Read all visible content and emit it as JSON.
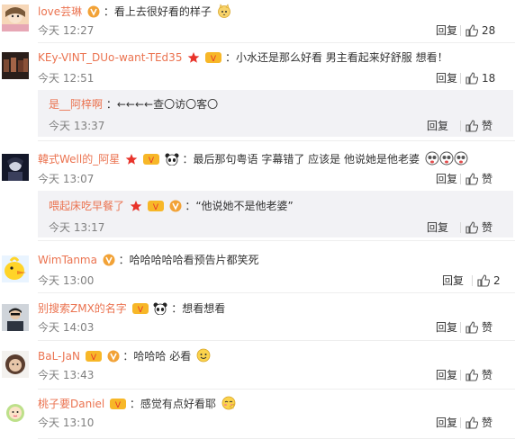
{
  "comments": [
    {
      "user": "love芸琳",
      "text": "：看上去很好看的样子",
      "time": "今天 12:27",
      "reply": "回复",
      "likes": "28"
    },
    {
      "user": "KEy-VINT_DUo-want-TEd35",
      "text": "：小水还是那么好看 男主看起来好舒服 想看！",
      "time": "今天 12:51",
      "reply": "回复",
      "likes": "18",
      "sub": {
        "user": "是__阿梓啊",
        "text": "：←←←←查〇访〇客〇",
        "time": "今天 13:37",
        "reply": "回复",
        "likes": "赞"
      }
    },
    {
      "user": "韓式Well的_阿星",
      "text": "：最后那句粤语 字幕错了 应该是 他说她是他老婆",
      "time": "今天 13:07",
      "reply": "回复",
      "likes": "赞",
      "sub": {
        "user": "喂起床吃早餐了",
        "text": "：“他说她不是他老婆”",
        "time": "今天 13:17",
        "reply": "回复",
        "likes": "赞"
      }
    },
    {
      "user": "WimTanma",
      "text": "：哈哈哈哈哈看预告片都笑死",
      "time": "今天 13:00",
      "reply": "回复",
      "likes": "2"
    },
    {
      "user": "别搜索ZMX的名字",
      "text": "：想看想看",
      "time": "今天 14:03",
      "reply": "回复",
      "likes": "赞"
    },
    {
      "user": "BaL-JaN",
      "text": "：哈哈哈  必看",
      "time": "今天 13:43",
      "reply": "回复",
      "likes": "赞"
    },
    {
      "user": "桃子要Daniel",
      "text": "：感觉有点好看耶",
      "time": "今天 13:10",
      "reply": "回复",
      "likes": "赞"
    }
  ],
  "colors": {
    "username": "#eb7350",
    "time": "#808080",
    "reply_bg": "#f2f2f5"
  }
}
